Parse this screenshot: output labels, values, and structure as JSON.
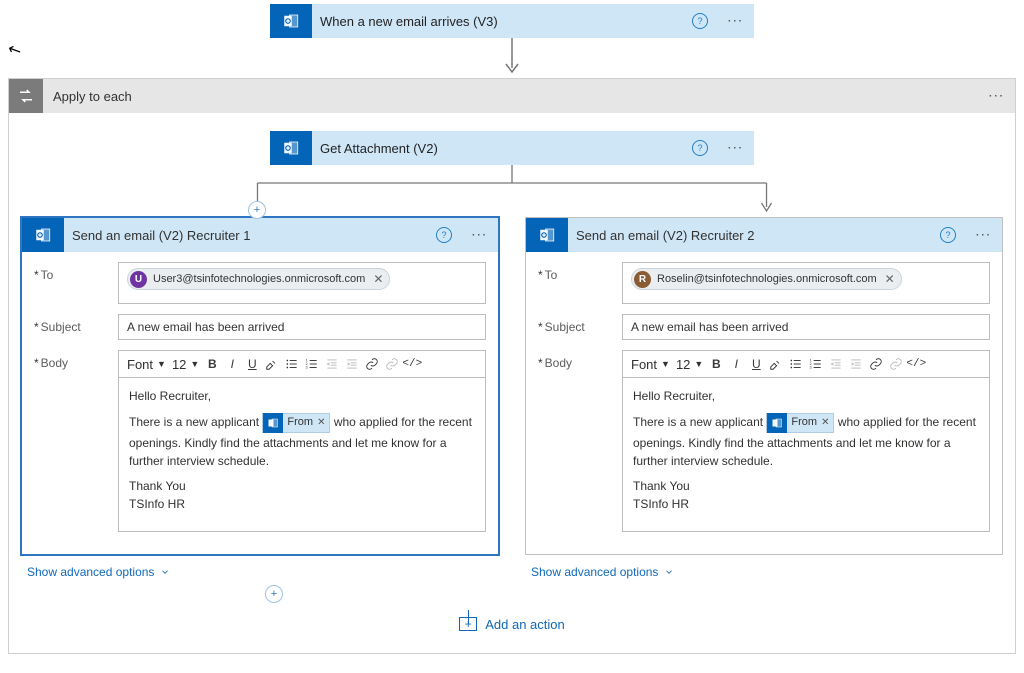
{
  "trigger": {
    "title": "When a new email arrives (V3)"
  },
  "applyToEach": {
    "title": "Apply to each",
    "getAttachment": {
      "title": "Get Attachment (V2)"
    }
  },
  "cards": [
    {
      "title": "Send an email (V2) Recruiter 1",
      "to": {
        "label": "To",
        "chipInitial": "U",
        "chipColor": "#7034a2",
        "chipEmail": "User3@tsinfotechnologies.onmicrosoft.com"
      },
      "subject": {
        "label": "Subject",
        "value": "A new email has been arrived"
      },
      "body": {
        "label": "Body",
        "font": "Font",
        "size": "12",
        "greeting": "Hello Recruiter,",
        "leadIn": "There is a new applicant",
        "token": "From",
        "afterToken": "who applied for the recent",
        "line2": "openings. Kindly find the attachments and let me know for a further interview schedule.",
        "thanks": "Thank You",
        "sign": "TSInfo HR"
      },
      "advanced": "Show advanced options",
      "selected": true
    },
    {
      "title": "Send an email (V2) Recruiter 2",
      "to": {
        "label": "To",
        "chipInitial": "R",
        "chipColor": "#8a5c34",
        "chipEmail": "Roselin@tsinfotechnologies.onmicrosoft.com"
      },
      "subject": {
        "label": "Subject",
        "value": "A new email has been arrived"
      },
      "body": {
        "label": "Body",
        "font": "Font",
        "size": "12",
        "greeting": "Hello Recruiter,",
        "leadIn": "There is a new applicant",
        "token": "From",
        "afterToken": "who applied for the recent",
        "line2": "openings. Kindly find the attachments and let me know for a further interview schedule.",
        "thanks": "Thank You",
        "sign": "TSInfo HR"
      },
      "advanced": "Show advanced options",
      "selected": false
    }
  ],
  "addAction": "Add an action"
}
